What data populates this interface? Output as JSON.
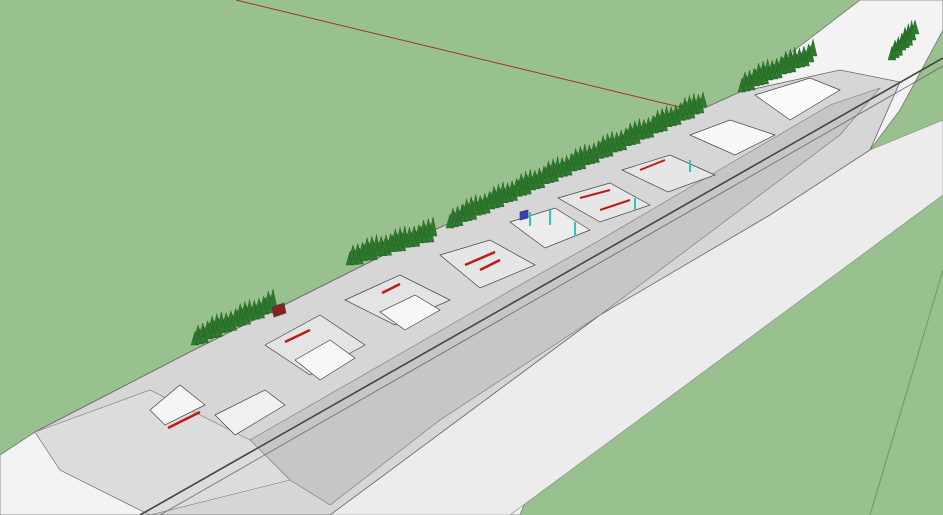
{
  "viewport": {
    "colors": {
      "ground": "#98c18f",
      "slope": "#f2f2f2",
      "pad": "#d4d4d4",
      "pad_dark": "#c4c4c4",
      "edge": "#555555",
      "tree": "#2f7a2f",
      "tree_trunk": "#6b4a1e",
      "rail_red": "#c0191b",
      "pole_cyan": "#2ec4c4",
      "axis_red": "#a03030"
    },
    "tree_rows": 3
  }
}
